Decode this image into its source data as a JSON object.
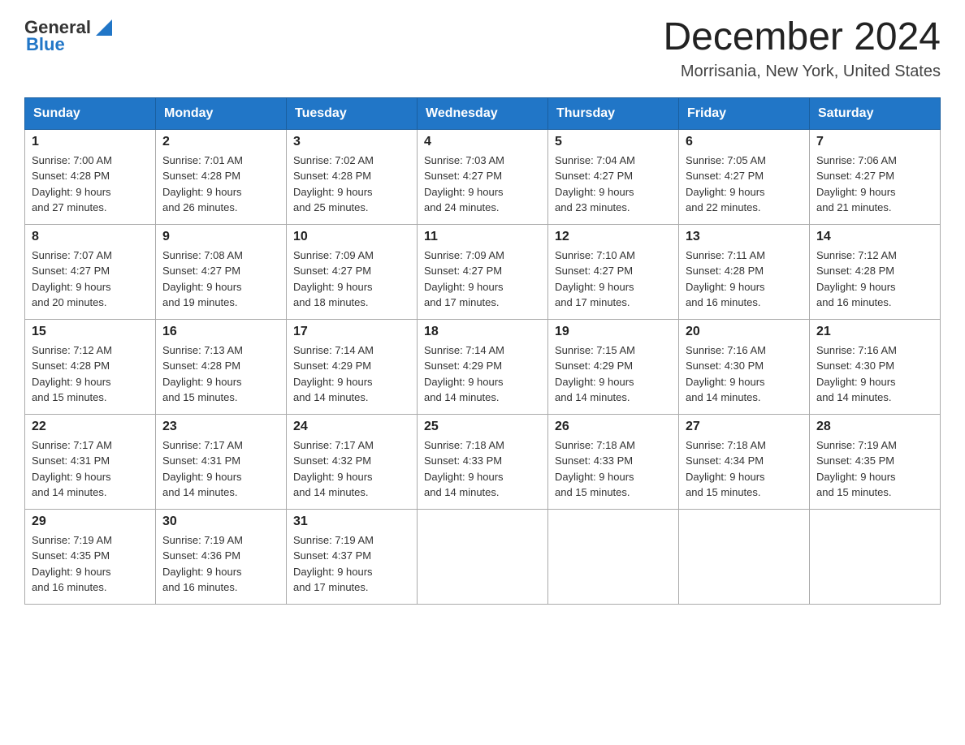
{
  "header": {
    "logo_general": "General",
    "logo_blue": "Blue",
    "month_title": "December 2024",
    "location": "Morrisania, New York, United States"
  },
  "days_of_week": [
    "Sunday",
    "Monday",
    "Tuesday",
    "Wednesday",
    "Thursday",
    "Friday",
    "Saturday"
  ],
  "weeks": [
    [
      {
        "day": "1",
        "sunrise": "7:00 AM",
        "sunset": "4:28 PM",
        "daylight": "9 hours and 27 minutes."
      },
      {
        "day": "2",
        "sunrise": "7:01 AM",
        "sunset": "4:28 PM",
        "daylight": "9 hours and 26 minutes."
      },
      {
        "day": "3",
        "sunrise": "7:02 AM",
        "sunset": "4:28 PM",
        "daylight": "9 hours and 25 minutes."
      },
      {
        "day": "4",
        "sunrise": "7:03 AM",
        "sunset": "4:27 PM",
        "daylight": "9 hours and 24 minutes."
      },
      {
        "day": "5",
        "sunrise": "7:04 AM",
        "sunset": "4:27 PM",
        "daylight": "9 hours and 23 minutes."
      },
      {
        "day": "6",
        "sunrise": "7:05 AM",
        "sunset": "4:27 PM",
        "daylight": "9 hours and 22 minutes."
      },
      {
        "day": "7",
        "sunrise": "7:06 AM",
        "sunset": "4:27 PM",
        "daylight": "9 hours and 21 minutes."
      }
    ],
    [
      {
        "day": "8",
        "sunrise": "7:07 AM",
        "sunset": "4:27 PM",
        "daylight": "9 hours and 20 minutes."
      },
      {
        "day": "9",
        "sunrise": "7:08 AM",
        "sunset": "4:27 PM",
        "daylight": "9 hours and 19 minutes."
      },
      {
        "day": "10",
        "sunrise": "7:09 AM",
        "sunset": "4:27 PM",
        "daylight": "9 hours and 18 minutes."
      },
      {
        "day": "11",
        "sunrise": "7:09 AM",
        "sunset": "4:27 PM",
        "daylight": "9 hours and 17 minutes."
      },
      {
        "day": "12",
        "sunrise": "7:10 AM",
        "sunset": "4:27 PM",
        "daylight": "9 hours and 17 minutes."
      },
      {
        "day": "13",
        "sunrise": "7:11 AM",
        "sunset": "4:28 PM",
        "daylight": "9 hours and 16 minutes."
      },
      {
        "day": "14",
        "sunrise": "7:12 AM",
        "sunset": "4:28 PM",
        "daylight": "9 hours and 16 minutes."
      }
    ],
    [
      {
        "day": "15",
        "sunrise": "7:12 AM",
        "sunset": "4:28 PM",
        "daylight": "9 hours and 15 minutes."
      },
      {
        "day": "16",
        "sunrise": "7:13 AM",
        "sunset": "4:28 PM",
        "daylight": "9 hours and 15 minutes."
      },
      {
        "day": "17",
        "sunrise": "7:14 AM",
        "sunset": "4:29 PM",
        "daylight": "9 hours and 14 minutes."
      },
      {
        "day": "18",
        "sunrise": "7:14 AM",
        "sunset": "4:29 PM",
        "daylight": "9 hours and 14 minutes."
      },
      {
        "day": "19",
        "sunrise": "7:15 AM",
        "sunset": "4:29 PM",
        "daylight": "9 hours and 14 minutes."
      },
      {
        "day": "20",
        "sunrise": "7:16 AM",
        "sunset": "4:30 PM",
        "daylight": "9 hours and 14 minutes."
      },
      {
        "day": "21",
        "sunrise": "7:16 AM",
        "sunset": "4:30 PM",
        "daylight": "9 hours and 14 minutes."
      }
    ],
    [
      {
        "day": "22",
        "sunrise": "7:17 AM",
        "sunset": "4:31 PM",
        "daylight": "9 hours and 14 minutes."
      },
      {
        "day": "23",
        "sunrise": "7:17 AM",
        "sunset": "4:31 PM",
        "daylight": "9 hours and 14 minutes."
      },
      {
        "day": "24",
        "sunrise": "7:17 AM",
        "sunset": "4:32 PM",
        "daylight": "9 hours and 14 minutes."
      },
      {
        "day": "25",
        "sunrise": "7:18 AM",
        "sunset": "4:33 PM",
        "daylight": "9 hours and 14 minutes."
      },
      {
        "day": "26",
        "sunrise": "7:18 AM",
        "sunset": "4:33 PM",
        "daylight": "9 hours and 15 minutes."
      },
      {
        "day": "27",
        "sunrise": "7:18 AM",
        "sunset": "4:34 PM",
        "daylight": "9 hours and 15 minutes."
      },
      {
        "day": "28",
        "sunrise": "7:19 AM",
        "sunset": "4:35 PM",
        "daylight": "9 hours and 15 minutes."
      }
    ],
    [
      {
        "day": "29",
        "sunrise": "7:19 AM",
        "sunset": "4:35 PM",
        "daylight": "9 hours and 16 minutes."
      },
      {
        "day": "30",
        "sunrise": "7:19 AM",
        "sunset": "4:36 PM",
        "daylight": "9 hours and 16 minutes."
      },
      {
        "day": "31",
        "sunrise": "7:19 AM",
        "sunset": "4:37 PM",
        "daylight": "9 hours and 17 minutes."
      },
      null,
      null,
      null,
      null
    ]
  ],
  "labels": {
    "sunrise": "Sunrise:",
    "sunset": "Sunset:",
    "daylight": "Daylight:"
  }
}
